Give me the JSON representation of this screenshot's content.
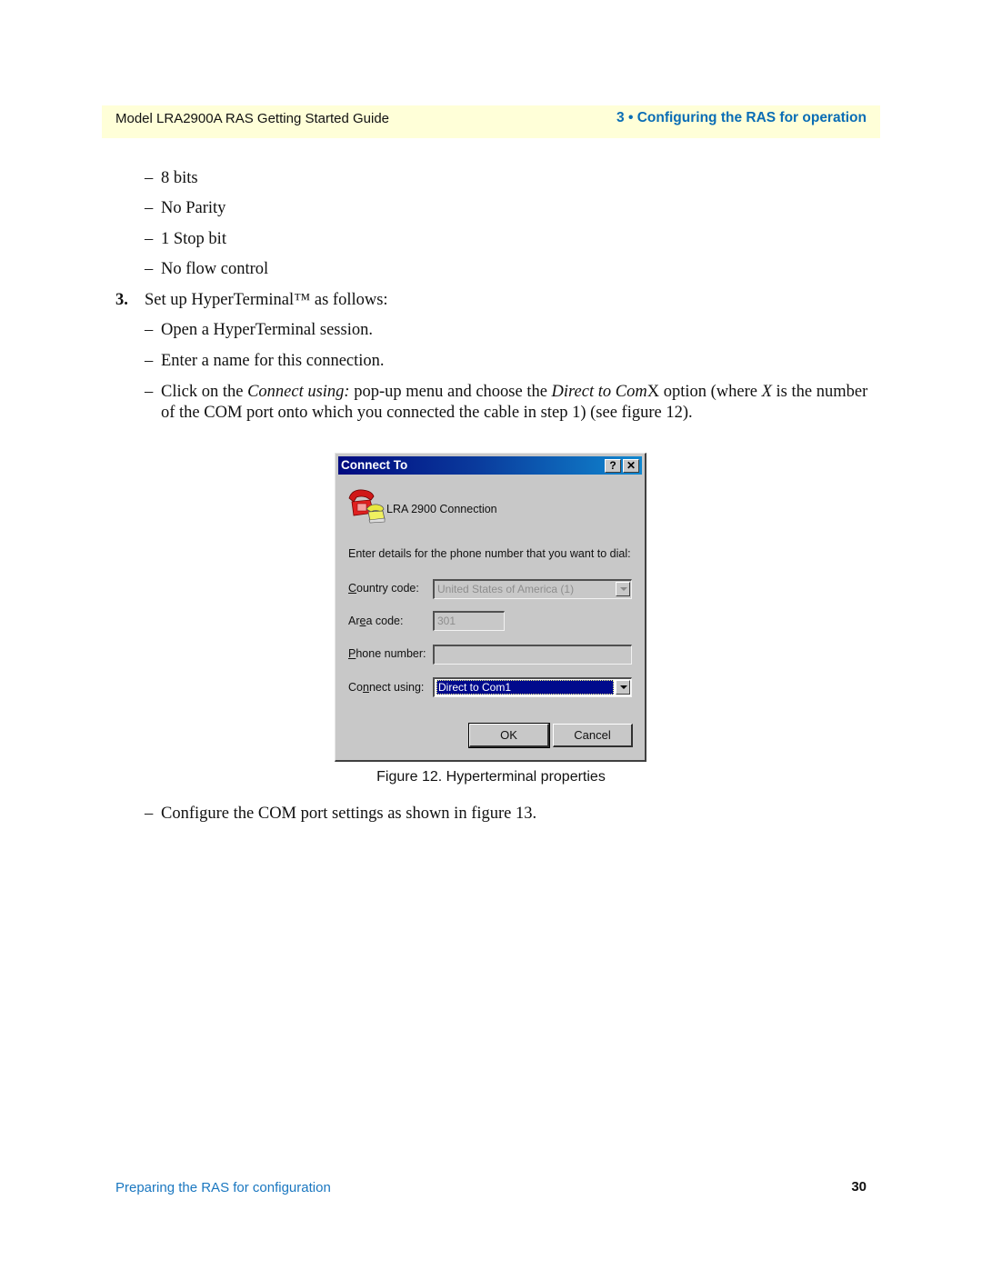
{
  "header": {
    "guide_title": "Model LRA2900A RAS Getting Started Guide",
    "chapter": "3 • Configuring the RAS for operation"
  },
  "body": {
    "bullets_top": [
      "8 bits",
      "No Parity",
      "1 Stop bit",
      "No flow control"
    ],
    "step3": {
      "number": "3.",
      "text": "Set up HyperTerminal™ as follows:",
      "substeps": [
        "Open a HyperTerminal session.",
        "Enter a name for this connection."
      ],
      "connect_step": {
        "p1": "Click on the ",
        "i1": "Connect using:",
        "p2": " pop-up menu and choose the ",
        "i2": "Direct to Com",
        "p3": "X option (where ",
        "i3": "X",
        "p4": " is the number",
        "line2": "of the COM port onto which you connected the cable in step 1) (see figure 12)."
      },
      "final_substep": "Configure the COM port settings as shown in figure 13."
    }
  },
  "dialog": {
    "title": "Connect To",
    "help_button": "?",
    "close_button": "✕",
    "connection_name": "LRA 2900 Connection",
    "prompt": "Enter details for the phone number that you want to dial:",
    "country_code": {
      "label_accel": "C",
      "label_rest": "ountry code:",
      "value": "United States of America (1)"
    },
    "area_code": {
      "label_pre": "Ar",
      "label_accel": "e",
      "label_rest": "a code:",
      "value": "301"
    },
    "phone_number": {
      "label_accel": "P",
      "label_rest": "hone number:",
      "value": ""
    },
    "connect_using": {
      "label_pre": "Co",
      "label_accel": "n",
      "label_rest": "nect using:",
      "value": "Direct to Com1"
    },
    "ok_label": "OK",
    "cancel_label": "Cancel"
  },
  "figure_caption": "Figure 12. Hyperterminal properties",
  "footer": {
    "section": "Preparing the RAS for configuration",
    "page_number": "30"
  }
}
